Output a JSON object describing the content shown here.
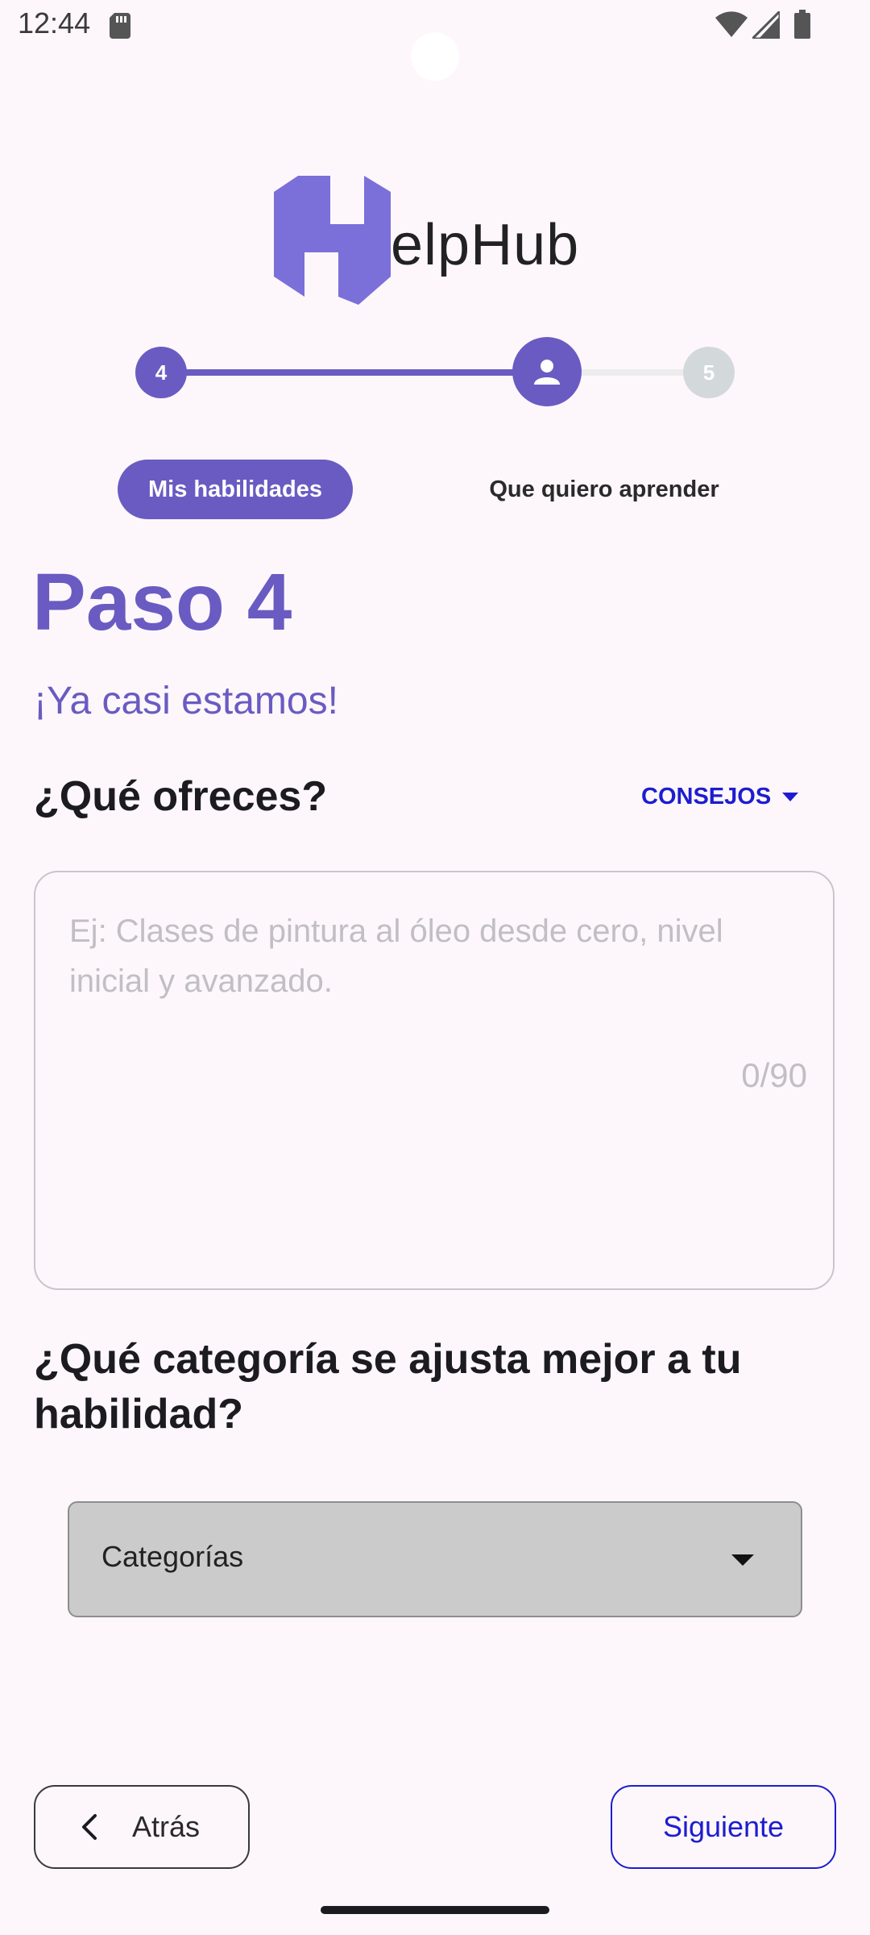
{
  "status_bar": {
    "time": "12:44",
    "icons": [
      "sd-card-icon",
      "wifi-icon",
      "signal-icon",
      "battery-icon"
    ]
  },
  "logo": {
    "text": "elpHub",
    "icon": "helphub-h-logo-icon",
    "color": "#7b6fd9"
  },
  "stepper": {
    "previous_step": "4",
    "current_step_icon": "person-icon",
    "next_step": "5",
    "active_color": "#6a5bc2",
    "inactive_color": "#d3d8db"
  },
  "tabs": [
    {
      "label": "Mis habilidades",
      "selected": true
    },
    {
      "label": "Que quiero aprender",
      "selected": false
    }
  ],
  "main": {
    "title": "Paso 4",
    "subtitle": "¡Ya casi estamos!",
    "offer_question": "¿Qué ofreces?",
    "tips_label": "CONSEJOS",
    "offer_placeholder": "Ej: Clases de pintura al óleo desde cero, nivel inicial y avanzado.",
    "offer_value": "",
    "offer_counter": "0/90",
    "category_question": "¿Qué categoría se ajusta mejor a tu habilidad?",
    "category_selected": "Categorías"
  },
  "footer": {
    "back_label": "Atrás",
    "next_label": "Siguiente",
    "accent": "#1d1dcf"
  }
}
